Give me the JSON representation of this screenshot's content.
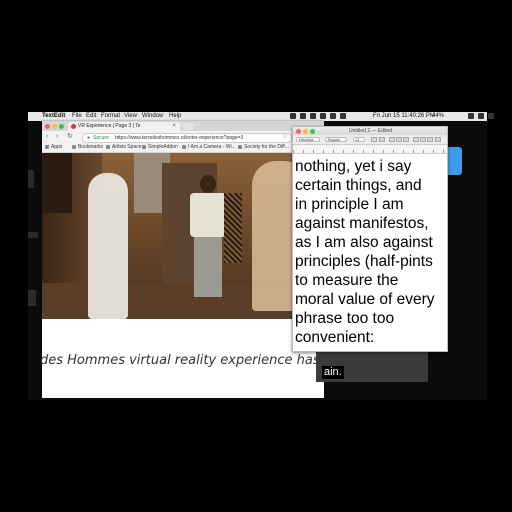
{
  "menubar": {
    "app": "TextEdit",
    "items": [
      "File",
      "Edit",
      "Format",
      "View",
      "Window",
      "Help"
    ],
    "clock": "Fri Jun 15  11:40:26 PM",
    "battery": "44%"
  },
  "browser": {
    "tab_title": "VR Experience | Page 3 | Te",
    "tab_close": "×",
    "secure_label": "Secure",
    "url": "https://www.terredeshommes.nl/enter-experience?page=3",
    "bookmarks": [
      "Apps",
      "Bookmarks",
      "Artists Space",
      "SimpleAddon",
      "I Am a Camera - Wi...",
      "Society for the Diff..."
    ],
    "caption": "des Hommes virtual reality experience has been"
  },
  "textedit": {
    "title": "Untitled 2 — Edited",
    "font": "Helvetica",
    "style": "Regular",
    "size": "12",
    "lines": [
      "nothing, yet i say",
      "certain things, and",
      "in principle I am",
      "against manifestos,",
      "as I am also against",
      "principles (half-pints",
      "to measure the",
      "moral value of every",
      "phrase too too",
      "convenient:"
    ]
  },
  "video_subtitle_tail": "ain.",
  "colors": {
    "secure": "#1a8a36",
    "desktop_icon": "#3d9be9",
    "traffic_close": "#fc605c",
    "traffic_min": "#fdbc40",
    "traffic_max": "#34c84a"
  }
}
